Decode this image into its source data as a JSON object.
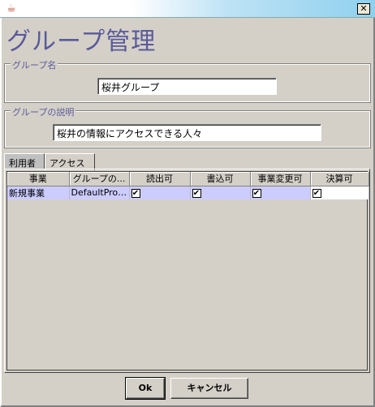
{
  "window": {
    "icon": "java-coffee-icon",
    "close_glyph": "✕"
  },
  "page_title": "グループ管理",
  "group_name": {
    "legend": "グループ名",
    "value": "桜井グループ"
  },
  "group_desc": {
    "legend": "グループの説明",
    "value": "桜井の情報にアクセスできる人々"
  },
  "tabs": [
    {
      "label": "利用者",
      "active": false
    },
    {
      "label": "アクセス",
      "active": true
    }
  ],
  "table": {
    "columns": [
      "事業",
      "グループの...",
      "読出可",
      "書込可",
      "事業変更可",
      "決算可"
    ],
    "rows": [
      {
        "business": "新規事業",
        "group": "DefaultProj...",
        "read": true,
        "write": true,
        "change": true,
        "settle": true
      }
    ]
  },
  "buttons": {
    "ok": "Ok",
    "cancel": "キャンセル"
  },
  "check_glyph": "✔"
}
